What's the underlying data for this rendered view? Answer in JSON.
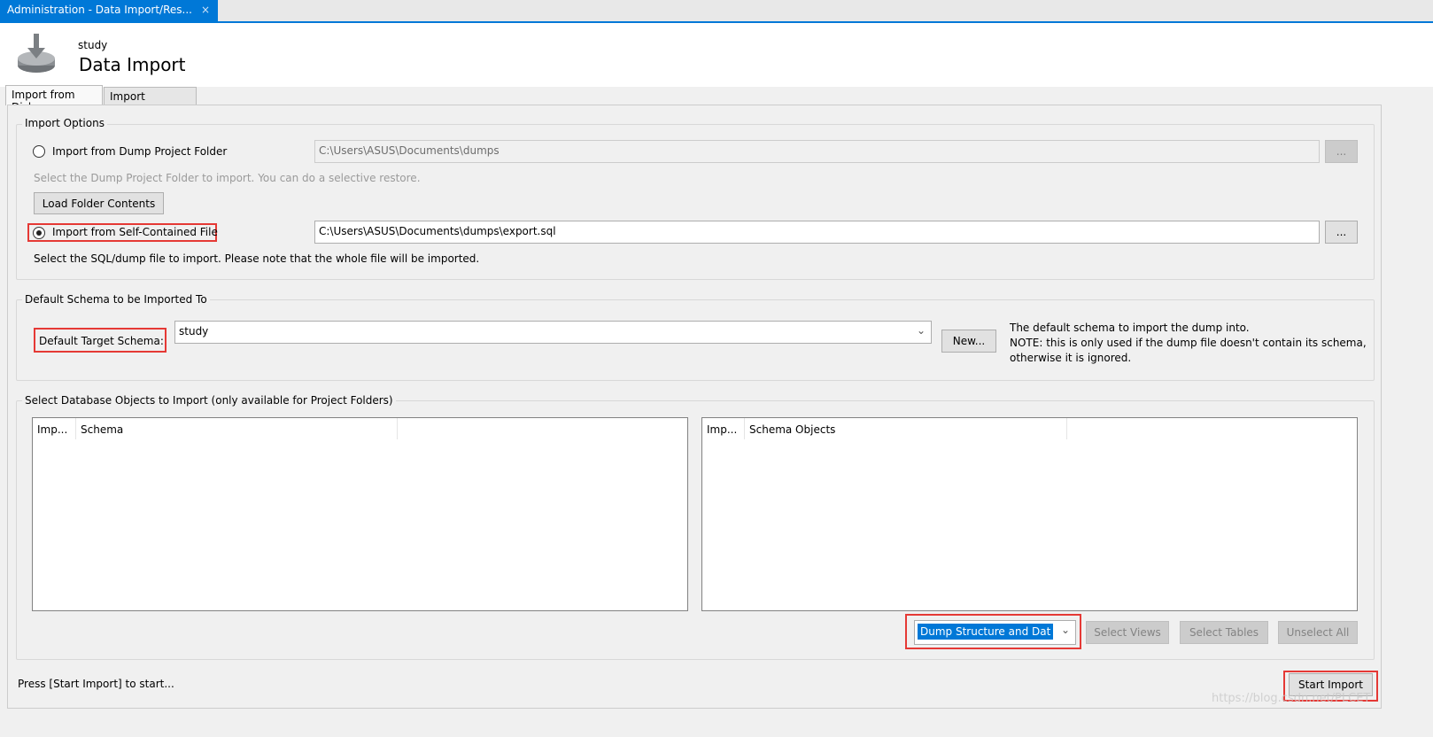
{
  "window": {
    "tab_title": "Administration - Data Import/Res...",
    "close_glyph": "×"
  },
  "header": {
    "schema": "study",
    "title": "Data Import",
    "icon": "import-disk-icon"
  },
  "tabs": [
    {
      "label": "Import from Disk",
      "active": true
    },
    {
      "label": "Import Progress",
      "active": false
    }
  ],
  "import_options": {
    "legend": "Import Options",
    "folder_radio": "Import from Dump Project Folder",
    "folder_path": "C:\\Users\\ASUS\\Documents\\dumps",
    "browse": "...",
    "folder_hint": "Select the Dump Project Folder to import. You can do a selective restore.",
    "load_button": "Load Folder Contents",
    "file_radio": "Import from Self-Contained File",
    "file_path": "C:\\Users\\ASUS\\Documents\\dumps\\export.sql",
    "file_hint": "Select the SQL/dump file to import. Please note that the whole file will be imported.",
    "selected": "file"
  },
  "schema_group": {
    "legend": "Default Schema to be Imported To",
    "label": "Default Target Schema:",
    "value": "study",
    "new_button": "New...",
    "note1": "The default schema to import the dump into.",
    "note2": "NOTE: this is only used if the dump file doesn't contain its schema,",
    "note3": "otherwise it is ignored."
  },
  "objects_group": {
    "legend": "Select Database Objects to Import (only available for Project Folders)",
    "left_columns": [
      "Imp...",
      "Schema"
    ],
    "right_columns": [
      "Imp...",
      "Schema Objects"
    ],
    "dump_select": "Dump Structure and Dat",
    "select_views": "Select Views",
    "select_tables": "Select Tables",
    "unselect_all": "Unselect All"
  },
  "footer": {
    "status": "Press [Start Import] to start...",
    "start_button": "Start Import"
  },
  "watermark": "https://blog.csdn.net/PLCET",
  "colors": {
    "accent": "#0078d7",
    "annotation": "#e53935"
  }
}
